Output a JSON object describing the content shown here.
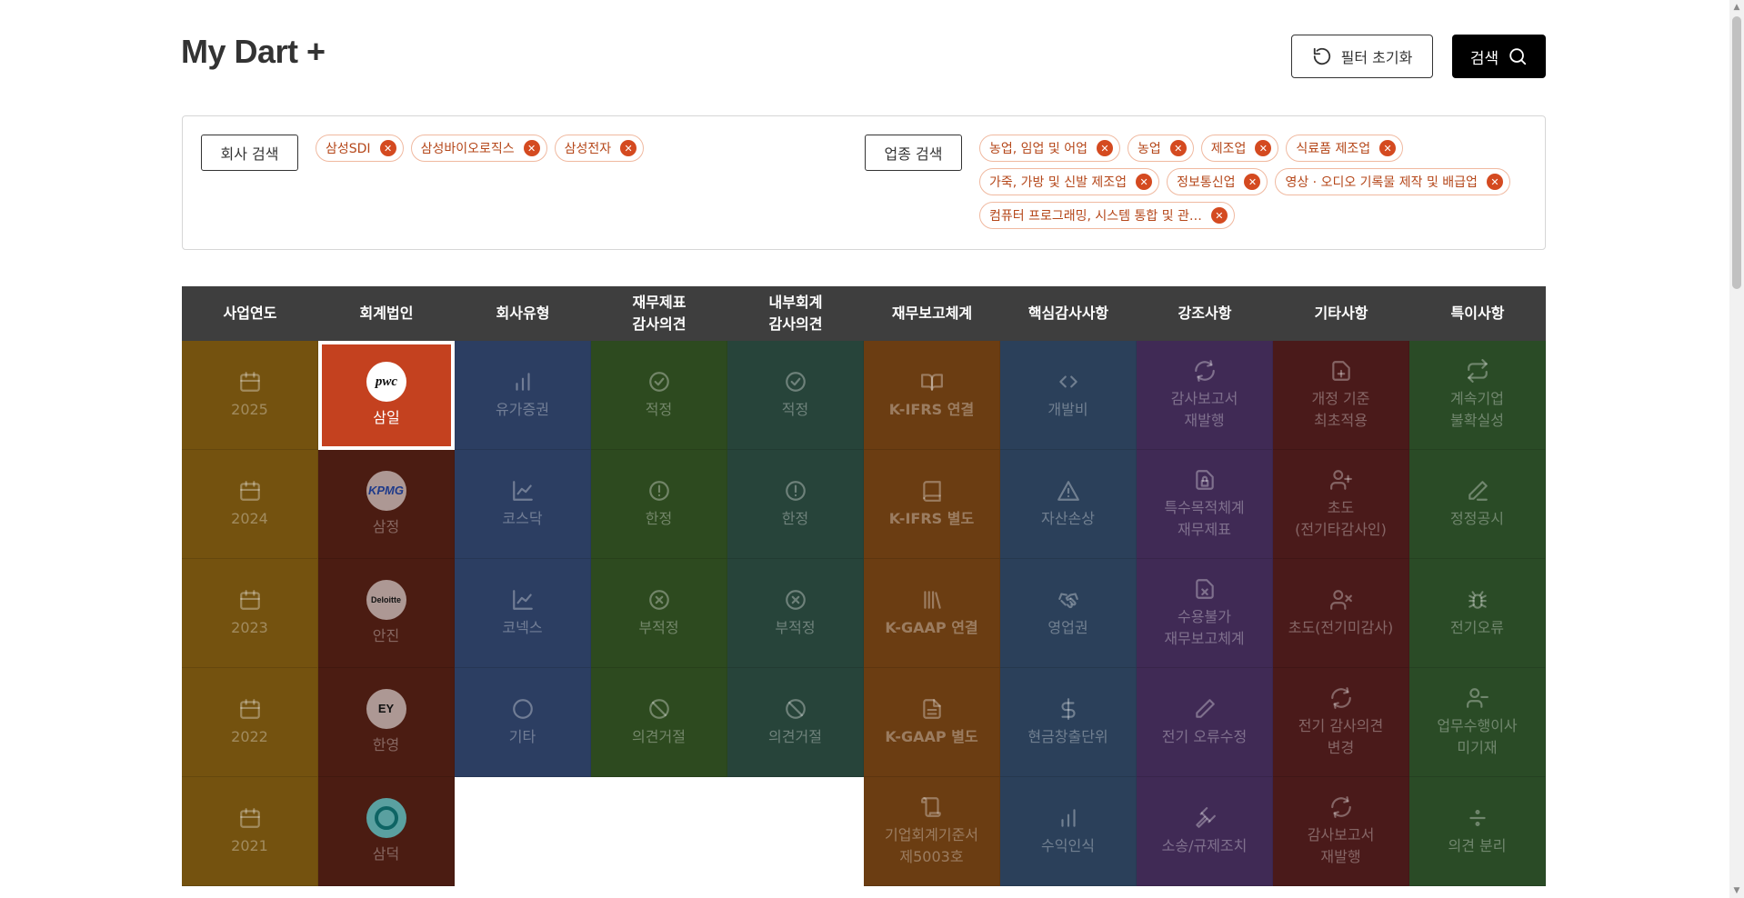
{
  "header": {
    "title": "My Dart +",
    "reset_label": "필터 초기화",
    "search_label": "검색"
  },
  "filters": {
    "company_btn": "회사 검색",
    "industry_btn": "업종 검색",
    "companies": [
      "삼성SDI",
      "삼성바이오로직스",
      "삼성전자"
    ],
    "industries": [
      "농업, 임업 및 어업",
      "농업",
      "제조업",
      "식료품 제조업",
      "가죽, 가방 및 신발 제조업",
      "정보통신업",
      "영상 · 오디오 기록물 제작 및 배급업",
      "컴퓨터 프로그래밍, 시스템 통합 및 관…"
    ]
  },
  "table": {
    "headers": [
      "사업연도",
      "회계법인",
      "회사유형",
      "재무제표\n감사의견",
      "내부회계\n감사의견",
      "재무보고체계",
      "핵심감사사항",
      "강조사항",
      "기타사항",
      "특이사항"
    ],
    "years": [
      {
        "label": "2025",
        "icon": "calendar-icon"
      },
      {
        "label": "2024",
        "icon": "calendar-icon"
      },
      {
        "label": "2023",
        "icon": "calendar-icon"
      },
      {
        "label": "2022",
        "icon": "calendar-icon"
      },
      {
        "label": "2021",
        "icon": "calendar-icon"
      }
    ],
    "firms": [
      {
        "label": "삼일",
        "logo": "pwc",
        "logo_text": "pwc",
        "selected": true
      },
      {
        "label": "삼정",
        "logo": "kpmg",
        "logo_text": "KPMG"
      },
      {
        "label": "안진",
        "logo": "deloitte",
        "logo_text": "Deloitte"
      },
      {
        "label": "한영",
        "logo": "ey",
        "logo_text": "EY"
      },
      {
        "label": "삼덕",
        "logo": "sd",
        "logo_text": ""
      }
    ],
    "types": [
      {
        "label": "유가증권",
        "icon": "bar-chart-icon"
      },
      {
        "label": "코스닥",
        "icon": "line-chart-icon"
      },
      {
        "label": "코넥스",
        "icon": "line-chart-icon"
      },
      {
        "label": "기타",
        "icon": "circle-icon"
      }
    ],
    "fin_opinion": [
      {
        "label": "적정",
        "icon": "check-circle-icon"
      },
      {
        "label": "한정",
        "icon": "alert-circle-icon"
      },
      {
        "label": "부적정",
        "icon": "x-circle-icon"
      },
      {
        "label": "의견거절",
        "icon": "ban-icon"
      }
    ],
    "int_opinion": [
      {
        "label": "적정",
        "icon": "check-circle-icon"
      },
      {
        "label": "한정",
        "icon": "alert-circle-icon"
      },
      {
        "label": "부적정",
        "icon": "x-circle-icon"
      },
      {
        "label": "의견거절",
        "icon": "ban-icon"
      }
    ],
    "frameworks": [
      {
        "label": "K-IFRS 연결",
        "icon": "book-open-icon",
        "bold": true
      },
      {
        "label": "K-IFRS 별도",
        "icon": "book-icon",
        "bold": true
      },
      {
        "label": "K-GAAP 연결",
        "icon": "library-icon",
        "bold": true
      },
      {
        "label": "K-GAAP 별도",
        "icon": "file-text-icon",
        "bold": true
      },
      {
        "label": "기업회계기준서\n제5003호",
        "icon": "scroll-icon"
      }
    ],
    "kam": [
      {
        "label": "개발비",
        "icon": "code-icon"
      },
      {
        "label": "자산손상",
        "icon": "warning-icon"
      },
      {
        "label": "영업권",
        "icon": "handshake-icon"
      },
      {
        "label": "현금창출단위",
        "icon": "dollar-icon"
      },
      {
        "label": "수익인식",
        "icon": "bar-chart-icon"
      }
    ],
    "emphasis": [
      {
        "label": "감사보고서\n재발행",
        "icon": "refresh-icon"
      },
      {
        "label": "특수목적체계\n재무제표",
        "icon": "file-lock-icon"
      },
      {
        "label": "수용불가\n재무보고체계",
        "icon": "file-x-icon"
      },
      {
        "label": "전기 오류수정",
        "icon": "pencil-icon"
      },
      {
        "label": "소송/규제조치",
        "icon": "gavel-icon"
      }
    ],
    "other": [
      {
        "label": "개정 기준\n최초적용",
        "icon": "file-plus-icon"
      },
      {
        "label": "초도\n(전기타감사인)",
        "icon": "user-plus-icon"
      },
      {
        "label": "초도(전기미감사)",
        "icon": "user-x-icon"
      },
      {
        "label": "전기 감사의견\n변경",
        "icon": "refresh-icon"
      },
      {
        "label": "감사보고서\n재발행",
        "icon": "refresh-icon"
      }
    ],
    "special": [
      {
        "label": "계속기업\n불확실성",
        "icon": "repeat-icon"
      },
      {
        "label": "정정공시",
        "icon": "pen-icon"
      },
      {
        "label": "전기오류",
        "icon": "bug-icon"
      },
      {
        "label": "업무수행이사\n미기재",
        "icon": "user-minus-icon"
      },
      {
        "label": "의견 분리",
        "icon": "divide-icon"
      }
    ]
  },
  "colors": {
    "accent": "#c4411f",
    "chip_text": "#b5471a",
    "header_bg": "#3e3e3e"
  }
}
